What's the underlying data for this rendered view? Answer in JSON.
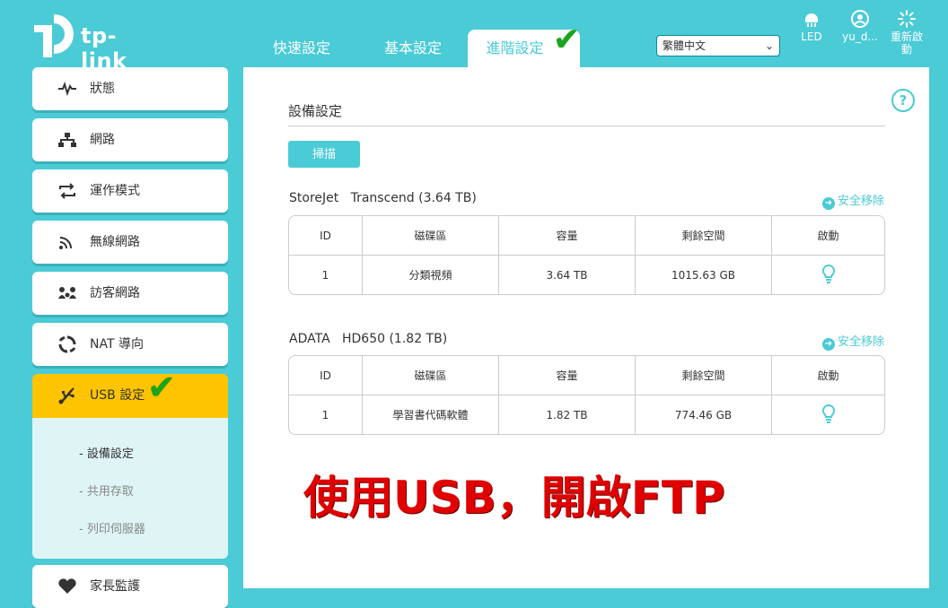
{
  "brand": {
    "name": "tp-link"
  },
  "tabs": [
    {
      "label": "快速設定",
      "active": false
    },
    {
      "label": "基本設定",
      "active": false
    },
    {
      "label": "進階設定",
      "active": true
    }
  ],
  "language": {
    "selected": "繁體中文"
  },
  "top_icons": {
    "led": "LED",
    "user": "yu_d...",
    "reboot_line1": "重新啟",
    "reboot_line2": "動"
  },
  "sidebar": {
    "items": [
      {
        "label": "狀態",
        "icon": "pulse-icon"
      },
      {
        "label": "網路",
        "icon": "network-icon"
      },
      {
        "label": "運作模式",
        "icon": "mode-swap-icon"
      },
      {
        "label": "無線網路",
        "icon": "wireless-icon"
      },
      {
        "label": "訪客網路",
        "icon": "guest-icon"
      },
      {
        "label": "NAT 導向",
        "icon": "nat-icon"
      },
      {
        "label": "USB 設定",
        "icon": "usb-icon",
        "active": true
      },
      {
        "label": "家長監護",
        "icon": "parental-icon"
      }
    ],
    "sub_items": [
      {
        "label": "- 設備設定",
        "active": true
      },
      {
        "label": "- 共用存取",
        "active": false
      },
      {
        "label": "- 列印伺服器",
        "active": false
      }
    ]
  },
  "main": {
    "section_title": "設備設定",
    "scan_button": "掃描",
    "eject_label": "安全移除",
    "columns": [
      "ID",
      "磁碟區",
      "容量",
      "剩餘空間",
      "啟動"
    ],
    "devices": [
      {
        "title": "StoreJet   Transcend (3.64 TB)",
        "rows": [
          {
            "id": "1",
            "volume": "分類視頻",
            "capacity": "3.64 TB",
            "free": "1015.63 GB"
          }
        ]
      },
      {
        "title": "ADATA   HD650 (1.82 TB)",
        "rows": [
          {
            "id": "1",
            "volume": "學習書代碼軟體",
            "capacity": "1.82 TB",
            "free": "774.46 GB"
          }
        ]
      }
    ]
  },
  "annotation": {
    "text": "使用USB，開啟FTP",
    "color": "#e00000"
  },
  "colors": {
    "accent": "#4acbd6",
    "active_nav": "#ffc400",
    "check": "#1aa51a"
  }
}
